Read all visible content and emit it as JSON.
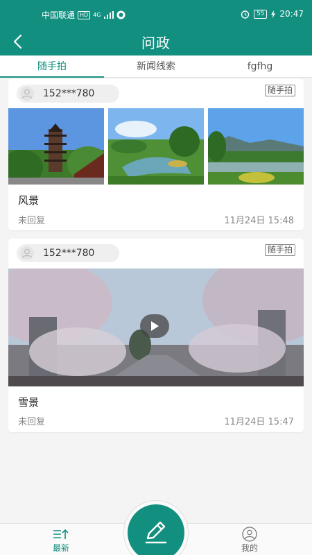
{
  "status_bar": {
    "carrier": "中国联通",
    "hd_badge": "HD",
    "network": "4G",
    "battery": "55",
    "time": "20:47"
  },
  "header": {
    "title": "问政",
    "back_icon": "chevron-left-icon"
  },
  "tabs": [
    {
      "label": "随手拍",
      "active": true
    },
    {
      "label": "新闻线索",
      "active": false
    },
    {
      "label": "fgfhg",
      "active": false
    }
  ],
  "posts": [
    {
      "user": "152***780",
      "tag": "随手拍",
      "media": "photos",
      "photos": [
        "pagoda-photo",
        "garden-pond-photo",
        "lake-hills-photo"
      ],
      "title": "风景",
      "status": "未回复",
      "time": "11月24日 15:48"
    },
    {
      "user": "152***780",
      "tag": "随手拍",
      "media": "video",
      "title": "雪景",
      "status": "未回复",
      "time": "11月24日 15:47"
    }
  ],
  "bottom_nav": {
    "latest_label": "最新",
    "mine_label": "我的",
    "compose_icon": "pencil-icon"
  },
  "colors": {
    "brand": "#138f80",
    "background": "#f4f4f4"
  }
}
